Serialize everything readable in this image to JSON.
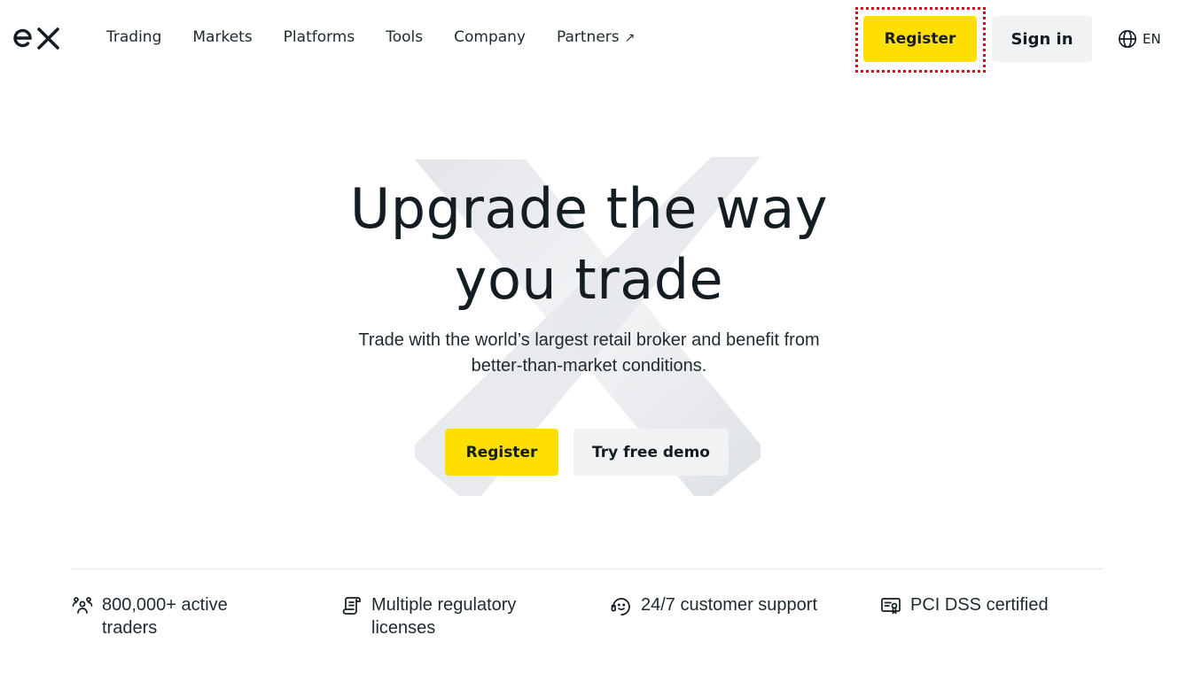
{
  "brand": {
    "logo_text": "ex",
    "accent_color": "#ffde02",
    "highlight_color": "#e30613"
  },
  "nav": {
    "items": [
      {
        "label": "Trading"
      },
      {
        "label": "Markets"
      },
      {
        "label": "Platforms"
      },
      {
        "label": "Tools"
      },
      {
        "label": "Company"
      },
      {
        "label": "Partners",
        "icon": "arrow-up-right-icon"
      }
    ]
  },
  "header": {
    "register_label": "Register",
    "signin_label": "Sign in",
    "language": "EN",
    "language_icon": "globe-icon"
  },
  "hero": {
    "title_line1": "Upgrade the way",
    "title_line2": "you trade",
    "subtitle_line1": "Trade with the world’s largest retail broker and benefit from",
    "subtitle_line2": "better-than-market conditions.",
    "register_label": "Register",
    "demo_label": "Try free demo"
  },
  "features": [
    {
      "icon": "users-icon",
      "text": "800,000+ active traders"
    },
    {
      "icon": "license-scroll-icon",
      "text": "Multiple regulatory licenses"
    },
    {
      "icon": "support-headset-icon",
      "text": "24/7 customer support"
    },
    {
      "icon": "certificate-icon",
      "text": "PCI DSS certified"
    }
  ]
}
